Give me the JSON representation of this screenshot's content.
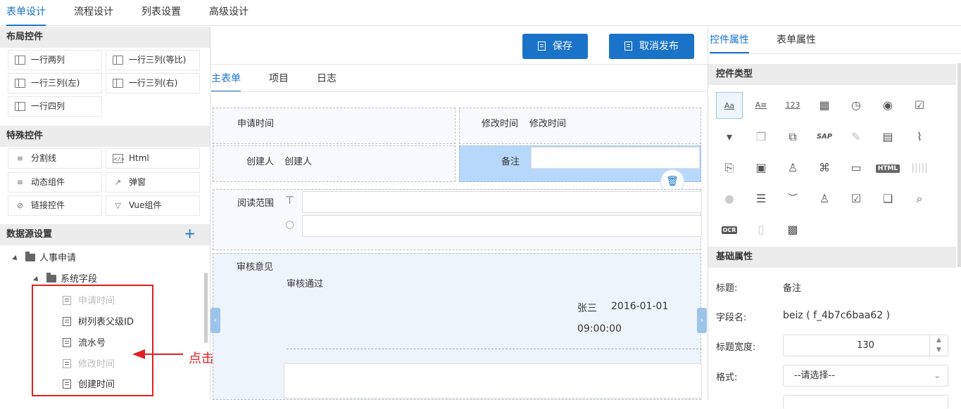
{
  "top_tabs": [
    "表单设计",
    "流程设计",
    "列表设置",
    "高级设计"
  ],
  "left": {
    "layout_title": "布局控件",
    "layout_items": [
      "一行两列",
      "一行三列(等比)",
      "一行三列(左)",
      "一行三列(右)",
      "一行四列"
    ],
    "special_title": "特殊控件",
    "special_items": [
      "分割线",
      "Html",
      "动态组件",
      "弹窗",
      "链接控件",
      "Vue组件"
    ],
    "datasource_title": "数据源设置",
    "plus_label": "+",
    "tree_root": "人事申请",
    "tree_child": "系统字段",
    "fields": [
      {
        "label": "申请时间",
        "disabled": true
      },
      {
        "label": "树列表父级ID",
        "disabled": false
      },
      {
        "label": "流水号",
        "disabled": false
      },
      {
        "label": "修改时间",
        "disabled": true
      },
      {
        "label": "创建时间",
        "disabled": false
      }
    ],
    "annotation": "点击添加"
  },
  "center": {
    "save_label": "保存",
    "unpublish_label": "取消发布",
    "sub_tabs": [
      "主表单",
      "项目",
      "日志"
    ],
    "apply_time_label": "申请时间",
    "modify_time_label": "修改时间",
    "modify_time_value": "修改时间",
    "creator_label": "创建人",
    "creator_value": "创建人",
    "remark_label": "备注",
    "read_scope_label": "阅读范围",
    "review_label": "审核意见",
    "review_text": "审核通过",
    "reviewer": "张三",
    "review_date": "2016-01-01",
    "review_time": "09:00:00"
  },
  "right": {
    "tabs": [
      "控件属性",
      "表单属性"
    ],
    "type_title": "控件类型",
    "icons": [
      "Aa",
      "A≡",
      "123",
      "calendar-icon",
      "clock-icon",
      "radio-icon",
      "checkbox-icon",
      "dropdown-icon",
      "copy-icon",
      "link-copy-icon",
      "SAP",
      "pen-icon",
      "document-icon",
      "paperclip-icon",
      "file-upload-icon",
      "image-icon",
      "user-icon",
      "org-icon",
      "text-box-icon",
      "HTML",
      "barcode-icon",
      "disabled-circle-icon",
      "list-icon",
      "signature-icon",
      "stamp-icon",
      "check-doc-icon",
      "multi-doc-icon",
      "search-doc-icon",
      "OCR",
      "blank-doc-icon",
      "qrcode-icon"
    ],
    "basic_title": "基础属性",
    "props": {
      "title_label": "标题:",
      "title_value": "备注",
      "field_label": "字段名:",
      "field_value": "beiz ( f_4b7c6baa62 )",
      "width_label": "标题宽度:",
      "width_value": "130",
      "format_label": "格式:",
      "format_value": "--请选择--"
    }
  },
  "colors": {
    "accent": "#1a73c8",
    "selected_cell": "#b8d8fb",
    "annotation": "#e02020"
  }
}
